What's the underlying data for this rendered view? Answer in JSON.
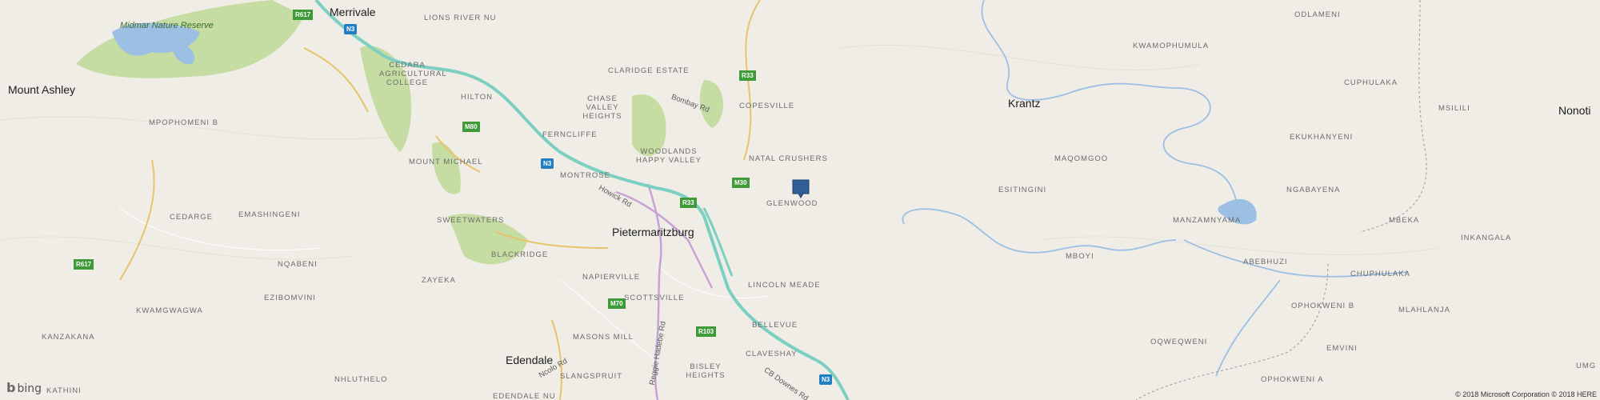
{
  "map": {
    "cities": [
      "Merrivale",
      "Mount Ashley",
      "Pietermaritzburg",
      "Krantz",
      "Nonoti",
      "Edendale"
    ],
    "suburbs": [
      "LIONS RIVER NU",
      "CEDARA AGRICULTURAL COLLEGE",
      "CLARIDGE ESTATE",
      "HILTON",
      "CHASE VALLEY HEIGHTS",
      "COPESVILLE",
      "MPOPHOMENI B",
      "FERNCLIFFE",
      "WOODLANDS HAPPY VALLEY",
      "NATAL CRUSHERS",
      "MOUNT MICHAEL",
      "MONTROSE",
      "GLENWOOD",
      "CEDARGE",
      "EMASHINGENI",
      "SWEETWATERS",
      "BLACKRIDGE",
      "NQABENI",
      "ZAYEKA",
      "NAPIERVILLE",
      "LINCOLN MEADE",
      "EZIBOMVINI",
      "KWAMGWAGWA",
      "SCOTTSVILLE",
      "BELLEVUE",
      "KANZAKANA",
      "MASONS MILL",
      "CLAVESHAY",
      "NHLUTHELO",
      "SLANGSPRUIT",
      "BISLEY HEIGHTS",
      "KATHINI",
      "EDENDALE NU",
      "ODLAMENI",
      "KWAMOPHUMULA",
      "CUPHULAKA",
      "MSILILI",
      "EKUKHANYENI",
      "MAQOMGOO",
      "ESITINGINI",
      "NGABAYENA",
      "MANZAMNYAMA",
      "MBEKA",
      "INKANGALA",
      "MBOYI",
      "ABEBHUZI",
      "CHUPHULAKA",
      "OPHOKWENI B",
      "MLAHLANJA",
      "OQWEQWENI",
      "EMVINI",
      "OPHOKWENI A",
      "UMG"
    ],
    "parks": [
      "Midmar Nature Reserve"
    ],
    "roads": [
      "Bombay Rd",
      "Howick Rd",
      "Reggie Hadebe Rd",
      "Ncolo Rd",
      "CB Downes Rd"
    ],
    "shields": [
      "N3",
      "R617",
      "R33",
      "M80",
      "M30",
      "R33",
      "R617",
      "M70",
      "R103",
      "N3",
      "N3"
    ],
    "attribution": "© 2018 Microsoft Corporation © 2018 HERE",
    "brand": "bing",
    "brand_glyph": "b",
    "colors": {
      "land": "#efede6",
      "water": "#9cc0e3",
      "park": "#c5dca2",
      "motorway": "#7ccfc1",
      "major": "#e8c36b",
      "arterial": "#c7a3d4",
      "pin": "#2f5f96"
    },
    "pin_icon": "map-pushpin-icon"
  }
}
